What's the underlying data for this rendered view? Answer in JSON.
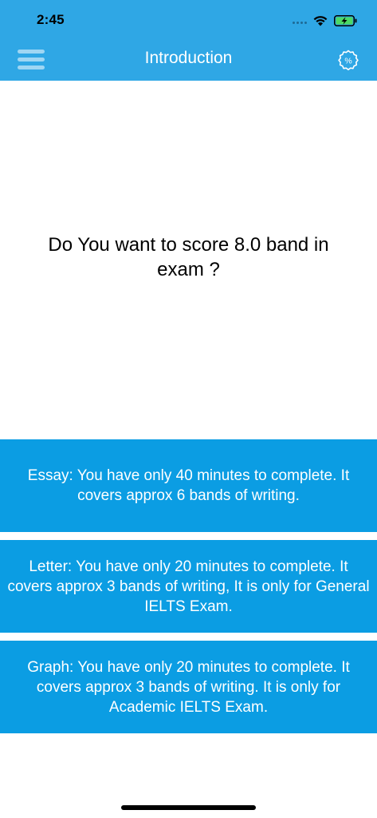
{
  "status_bar": {
    "time": "2:45",
    "icons": [
      "cellular-signal-icon",
      "wifi-icon",
      "battery-charging-icon"
    ]
  },
  "nav": {
    "title": "Introduction",
    "left_icon": "hamburger-menu-icon",
    "right_icon": "discount-badge-icon",
    "right_icon_glyph": "%"
  },
  "main": {
    "headline": "Do You want to score 8.0 band in exam ?"
  },
  "cards": [
    {
      "text": "Essay: You have only 40 minutes to complete. It covers approx 6 bands of writing."
    },
    {
      "text": "Letter: You have only 20 minutes to complete. It covers approx 3 bands of writing, It is only for General IELTS Exam."
    },
    {
      "text": "Graph: You have only 20 minutes to complete. It covers approx 3 bands of writing. It is only for Academic IELTS Exam."
    }
  ],
  "colors": {
    "nav_blue": "#2fa7e5",
    "card_blue": "#0b9de3",
    "battery_green": "#4cd964"
  }
}
